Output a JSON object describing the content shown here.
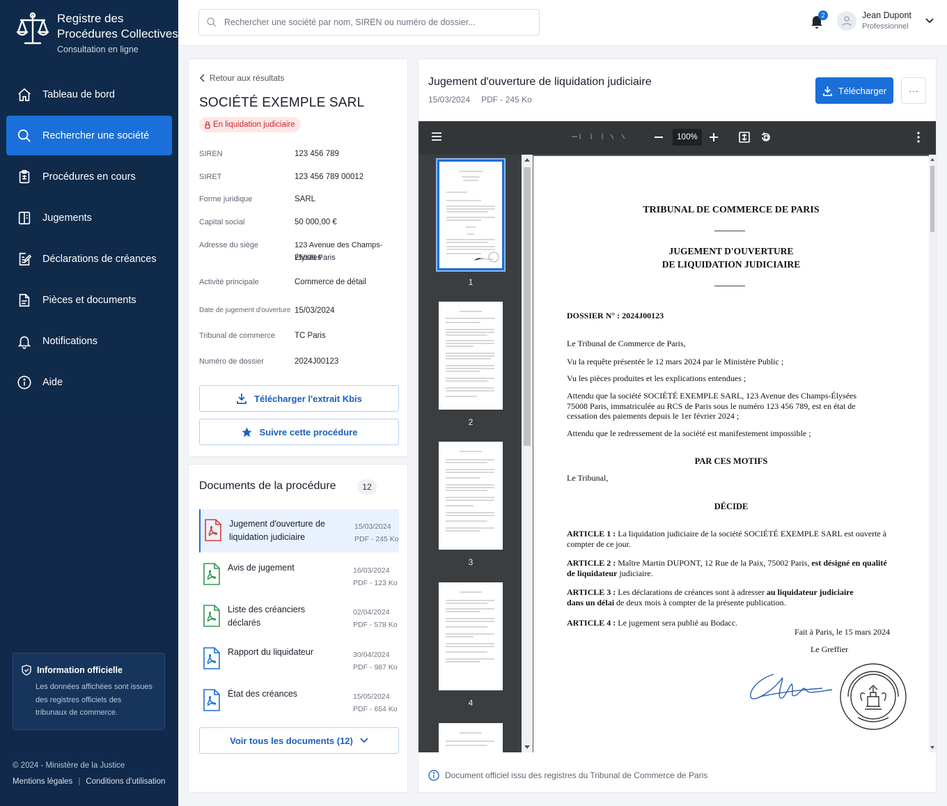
{
  "brand": {
    "title_line1": "Registre des",
    "title_line2": "Procédures Collectives",
    "subtitle": "Consultation en ligne"
  },
  "nav": [
    {
      "label": "Tableau de bord"
    },
    {
      "label": "Rechercher une société"
    },
    {
      "label": "Procédures en cours"
    },
    {
      "label": "Jugements"
    },
    {
      "label": "Déclarations de créances"
    },
    {
      "label": "Pièces et documents"
    },
    {
      "label": "Notifications"
    },
    {
      "label": "Aide"
    }
  ],
  "info": {
    "title": "Information officielle",
    "text": "Les données affichées sont issues des registres officiels des tribunaux de commerce."
  },
  "footer": {
    "copyright": "© 2024 - Ministère de la Justice",
    "legal": "Mentions légales",
    "terms": "Conditions d'utilisation",
    "separator": "|"
  },
  "search": {
    "placeholder": "Rechercher une société par nom, SIREN ou numéro de dossier..."
  },
  "notifications": {
    "count": "2"
  },
  "user": {
    "name": "Jean Dupont",
    "role": "Professionnel"
  },
  "company": {
    "back_label": "Retour aux résultats",
    "name": "SOCIÉTÉ EXEMPLE SARL",
    "status": "En liquidation judiciaire",
    "fields": [
      {
        "label": "SIREN",
        "value": "123 456 789"
      },
      {
        "label": "SIRET",
        "value": "123 456 789 00012"
      },
      {
        "label": "Forme juridique",
        "value": "SARL"
      },
      {
        "label": "Capital social",
        "value": "50 000,00 €"
      },
      {
        "label": "Adresse du siège",
        "value": "123 Avenue des Champs-Élysées",
        "value2": "75008 Paris"
      },
      {
        "label": "Activité principale",
        "value": "Commerce de détail"
      },
      {
        "label": "Date de jugement d'ouverture",
        "value": "15/03/2024"
      },
      {
        "label": "Tribunal de commerce",
        "value": "TC Paris"
      },
      {
        "label": "Numéro de dossier",
        "value": "2024J00123"
      }
    ],
    "kbis_button": "Télécharger l'extrait Kbis",
    "follow_button": "Suivre cette procédure"
  },
  "documents": {
    "title": "Documents de la procédure",
    "count": "12",
    "items": [
      {
        "title": "Jugement d'ouverture de liquidation judiciaire",
        "date": "15/03/2024",
        "meta": "PDF - 245 Ko",
        "color": "#d93a3a"
      },
      {
        "title": "Avis de jugement",
        "date": "16/03/2024",
        "meta": "PDF - 123 Ko",
        "color": "#2e9a4f"
      },
      {
        "title": "Liste des créanciers déclarés",
        "date": "02/04/2024",
        "meta": "PDF - 578 Ko",
        "color": "#2e9a4f"
      },
      {
        "title": "Rapport du liquidateur",
        "date": "30/04/2024",
        "meta": "PDF - 987 Ko",
        "color": "#1b6fd8"
      },
      {
        "title": "État des créances",
        "date": "15/05/2024",
        "meta": "PDF - 654 Ko",
        "color": "#1b6fd8"
      }
    ],
    "view_all": "Voir tous les documents (12)"
  },
  "viewer": {
    "title": "Jugement d'ouverture de liquidation judiciaire",
    "date": "15/03/2024",
    "meta": "PDF - 245 Ko",
    "download": "Télécharger",
    "more": "···",
    "zoom": "100%",
    "thumb_labels": [
      "1",
      "2",
      "3",
      "4"
    ],
    "footer": "Document officiel issu des registres du Tribunal de Commerce de Paris"
  },
  "pdf": {
    "court": "TRIBUNAL DE COMMERCE DE PARIS",
    "heading1": "JUGEMENT D'OUVERTURE",
    "heading2": "DE LIQUIDATION JUDICIAIRE",
    "dossier": "DOSSIER N° : 2024J00123",
    "l1": "Le Tribunal de Commerce de Paris,",
    "l2": "Vu la requête présentée le 12 mars 2024 par le Ministère Public ;",
    "l3": "Vu les pièces produites et les explications entendues ;",
    "l4": "Attendu que la société SOCIÉTÉ EXEMPLE SARL, 123 Avenue des Champs-Élysées 75008 Paris, immatriculée au RCS de Paris sous le numéro 123 456 789, est en état de cessation des paiements depuis le 1er février 2024 ;",
    "l5": "Attendu que le redressement de la société est manifestement impossible ;",
    "motifs": "PAR CES MOTIFS",
    "l6": "Le Tribunal,",
    "decide": "DÉCIDE",
    "a1_label": "ARTICLE 1 :",
    "a1": "La liquidation judiciaire de la société SOCIÉTÉ EXEMPLE SARL est ouverte à compter de ce jour.",
    "a2_label": "ARTICLE 2 :",
    "a2_a": "Maître Martin DUPONT, 12 Rue de la Paix, 75002 Paris,",
    "a2_b": "est désigné en qualité de liquidateur",
    "a2_c": "judiciaire.",
    "a3_label": "ARTICLE 3 :",
    "a3_a": "Les déclarations de créances sont à adresser",
    "a3_b": "au liquidateur judiciaire dans un délai",
    "a3_c": "de deux mois à compter de la présente publication.",
    "a4_label": "ARTICLE 4 :",
    "a4": "Le jugement sera publié au Bodacc.",
    "place_date": "Fait à Paris, le 15 mars 2024",
    "signer": "Le Greffier",
    "seal_text": "TRIBUNAL DE COMMERCE DE PARIS"
  }
}
